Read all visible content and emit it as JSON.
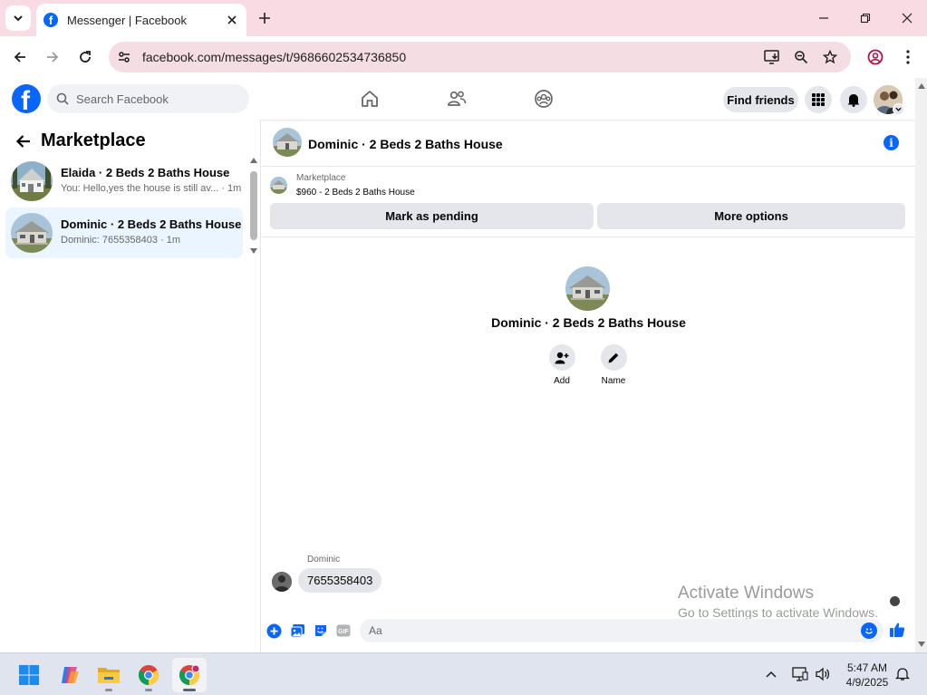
{
  "browser": {
    "tab_title": "Messenger | Facebook",
    "url": "facebook.com/messages/t/9686602534736850"
  },
  "facebook": {
    "search_placeholder": "Search Facebook",
    "find_friends_label": "Find friends",
    "brand_color": "#0866ff"
  },
  "sidebar": {
    "title": "Marketplace",
    "conversations": [
      {
        "name": "Elaida · 2 Beds 2 Baths House",
        "preview": "You: Hello,yes the house is still av... · 1m",
        "active": false
      },
      {
        "name": "Dominic · 2 Beds 2 Baths House",
        "preview": "Dominic: 7655358403 · 1m",
        "active": true
      }
    ]
  },
  "conversation": {
    "title": "Dominic · 2 Beds 2 Baths House",
    "listing": {
      "label": "Marketplace",
      "price_line": "$960 - 2 Beds 2 Baths House",
      "mark_pending_label": "Mark as pending",
      "more_options_label": "More options"
    },
    "intro": {
      "name": "Dominic · 2 Beds 2 Baths House",
      "actions": [
        {
          "label": "Add",
          "icon": "add-person-icon"
        },
        {
          "label": "Name",
          "icon": "pencil-icon"
        }
      ]
    },
    "messages": [
      {
        "sender": "Dominic",
        "text": "7655358403"
      }
    ],
    "composer_placeholder": "Aa"
  },
  "watermark": {
    "line1": "Activate Windows",
    "line2": "Go to Settings to activate Windows."
  },
  "taskbar": {
    "time": "5:47 AM",
    "date": "4/9/2025"
  }
}
